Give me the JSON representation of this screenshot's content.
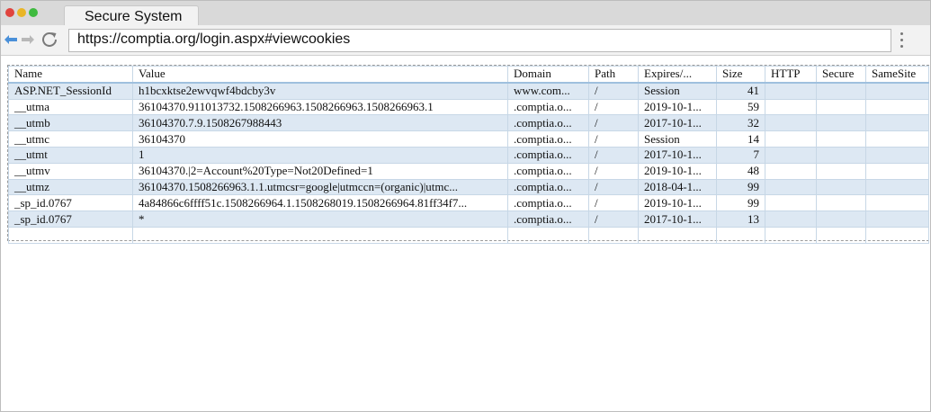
{
  "browser": {
    "tab_title": "Secure System",
    "url": "https://comptia.org/login.aspx#viewcookies"
  },
  "table": {
    "headers": [
      "Name",
      "Value",
      "Domain",
      "Path",
      "Expires/...",
      "Size",
      "HTTP",
      "Secure",
      "SameSite"
    ],
    "rows": [
      {
        "name": "ASP.NET_SessionId",
        "value": "h1bcxktse2ewvqwf4bdcby3v",
        "domain": "www.com...",
        "path": "/",
        "expires": "Session",
        "size": "41",
        "http": "",
        "secure": "",
        "samesite": ""
      },
      {
        "name": "__utma",
        "value": "36104370.911013732.1508266963.1508266963.1508266963.1",
        "domain": ".comptia.o...",
        "path": "/",
        "expires": "2019-10-1...",
        "size": "59",
        "http": "",
        "secure": "",
        "samesite": ""
      },
      {
        "name": "__utmb",
        "value": "36104370.7.9.1508267988443",
        "domain": ".comptia.o...",
        "path": "/",
        "expires": "2017-10-1...",
        "size": "32",
        "http": "",
        "secure": "",
        "samesite": ""
      },
      {
        "name": "__utmc",
        "value": "36104370",
        "domain": ".comptia.o...",
        "path": "/",
        "expires": "Session",
        "size": "14",
        "http": "",
        "secure": "",
        "samesite": ""
      },
      {
        "name": "__utmt",
        "value": "1",
        "domain": ".comptia.o...",
        "path": "/",
        "expires": "2017-10-1...",
        "size": "7",
        "http": "",
        "secure": "",
        "samesite": ""
      },
      {
        "name": "__utmv",
        "value": "36104370.|2=Account%20Type=Not20Defined=1",
        "domain": ".comptia.o...",
        "path": "/",
        "expires": "2019-10-1...",
        "size": "48",
        "http": "",
        "secure": "",
        "samesite": ""
      },
      {
        "name": "__utmz",
        "value": "36104370.1508266963.1.1.utmcsr=google|utmccn=(organic)|utmc...",
        "domain": ".comptia.o...",
        "path": "/",
        "expires": "2018-04-1...",
        "size": "99",
        "http": "",
        "secure": "",
        "samesite": ""
      },
      {
        "name": "_sp_id.0767",
        "value": "4a84866c6ffff51c.1508266964.1.1508268019.1508266964.81ff34f7...",
        "domain": ".comptia.o...",
        "path": "/",
        "expires": "2019-10-1...",
        "size": "99",
        "http": "",
        "secure": "",
        "samesite": ""
      },
      {
        "name": "_sp_id.0767",
        "value": "*",
        "domain": ".comptia.o...",
        "path": "/",
        "expires": "2017-10-1...",
        "size": "13",
        "http": "",
        "secure": "",
        "samesite": ""
      },
      {
        "name": "",
        "value": "",
        "domain": "",
        "path": "",
        "expires": "",
        "size": "",
        "http": "",
        "secure": "",
        "samesite": ""
      }
    ]
  },
  "colors": {
    "row_alt": "#dde8f3",
    "grid": "#c7d7e6",
    "back_arrow": "#4a90d9",
    "fwd_arrow": "#b8b8b8"
  },
  "icons": {
    "back": "back-arrow-icon",
    "forward": "forward-arrow-icon",
    "reload": "reload-icon",
    "menu": "kebab-menu-icon"
  }
}
